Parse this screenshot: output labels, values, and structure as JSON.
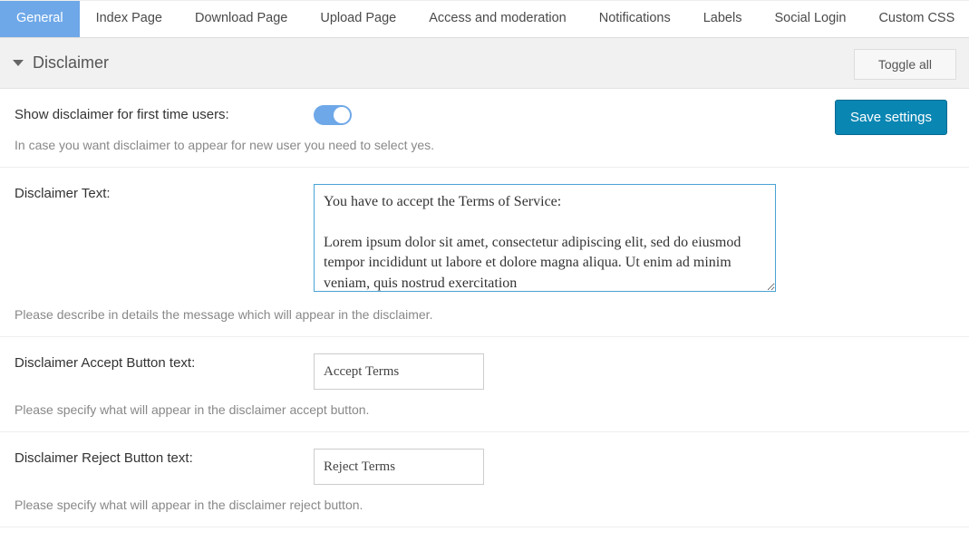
{
  "tabs": [
    {
      "label": "General",
      "active": true
    },
    {
      "label": "Index Page",
      "active": false
    },
    {
      "label": "Download Page",
      "active": false
    },
    {
      "label": "Upload Page",
      "active": false
    },
    {
      "label": "Access and moderation",
      "active": false
    },
    {
      "label": "Notifications",
      "active": false
    },
    {
      "label": "Labels",
      "active": false
    },
    {
      "label": "Social Login",
      "active": false
    },
    {
      "label": "Custom CSS",
      "active": false
    }
  ],
  "section": {
    "title": "Disclaimer",
    "toggle_all_label": "Toggle all"
  },
  "save_button_label": "Save settings",
  "settings": {
    "show_disclaimer": {
      "label": "Show disclaimer for first time users:",
      "help": "In case you want disclaimer to appear for new user you need to select yes.",
      "value": true
    },
    "disclaimer_text": {
      "label": "Disclaimer Text:",
      "help": "Please describe in details the message which will appear in the disclaimer.",
      "value": "You have to accept the Terms of Service:\n\nLorem ipsum dolor sit amet, consectetur adipiscing elit, sed do eiusmod tempor incididunt ut labore et dolore magna aliqua. Ut enim ad minim veniam, quis nostrud exercitation"
    },
    "accept_button": {
      "label": "Disclaimer Accept Button text:",
      "help": "Please specify what will appear in the disclaimer accept button.",
      "value": "Accept Terms"
    },
    "reject_button": {
      "label": "Disclaimer Reject Button text:",
      "help": "Please specify what will appear in the disclaimer reject button.",
      "value": "Reject Terms"
    }
  }
}
